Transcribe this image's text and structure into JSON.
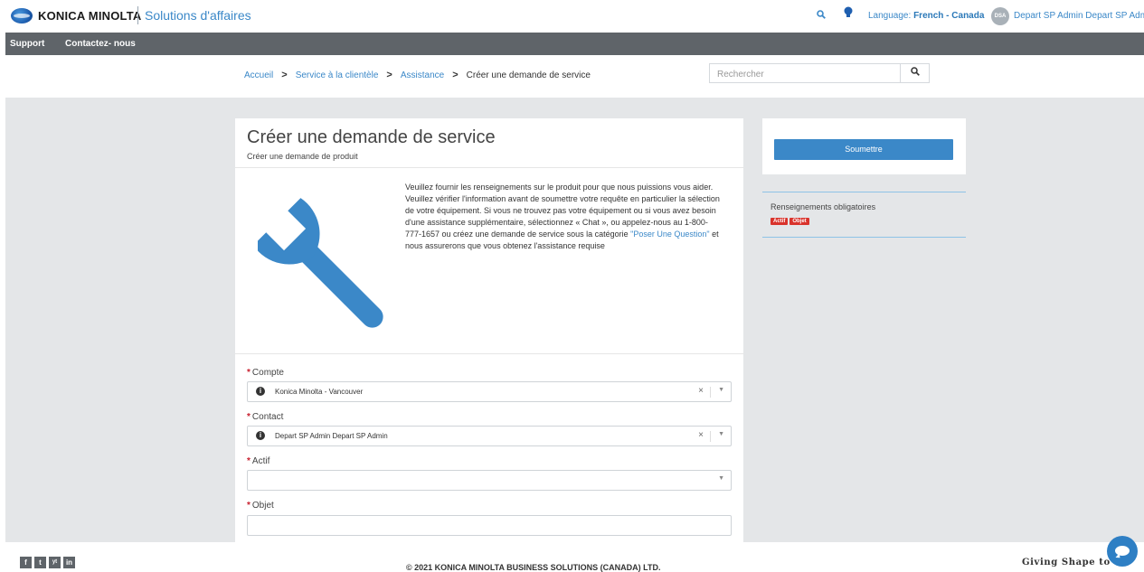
{
  "header": {
    "brand": "KONICA MINOLTA",
    "brand_sub": "Solutions d'affaires",
    "language_label": "Language:",
    "language_value": "French - Canada",
    "avatar_initials": "DSA",
    "user_name": "Depart SP Admin Depart SP Adm"
  },
  "nav": {
    "items": [
      {
        "label": "Support"
      },
      {
        "label": "Contactez- nous"
      }
    ]
  },
  "breadcrumb": {
    "items": [
      {
        "label": "Accueil"
      },
      {
        "label": "Service à la clientèle"
      },
      {
        "label": "Assistance"
      }
    ],
    "current": "Créer une demande de service",
    "separator": ">"
  },
  "search": {
    "placeholder": "Rechercher"
  },
  "form": {
    "title": "Créer une demande de service",
    "subtitle": "Créer une demande de produit",
    "intro_before_link": "Veuillez fournir les renseignements sur le produit pour que nous puissions vous aider. Veuillez vérifier l'information avant de soumettre votre requête en particulier la sélection de votre équipement. Si vous ne trouvez pas votre équipement ou si vous avez besoin d'une assistance supplémentaire, sélectionnez « Chat », ou appelez-nous au 1-800-777-1657 ou créez une demande de service sous la catégorie ",
    "intro_link": "\"Poser Une Question\"",
    "intro_after_link": " et nous assurerons que vous obtenez l'assistance requise",
    "fields": [
      {
        "label": "Compte",
        "required": "*",
        "value": "Konica Minolta - Vancouver"
      },
      {
        "label": "Contact",
        "required": "*",
        "value": "Depart SP Admin Depart SP Admin"
      },
      {
        "label": "Actif",
        "required": "*",
        "value": ""
      },
      {
        "label": "Objet",
        "required": "*",
        "value": ""
      }
    ],
    "clear_glyph": "×",
    "dropdown_glyph": "▼"
  },
  "side": {
    "submit_label": "Soumettre",
    "required_title": "Renseignements obligatoires",
    "required_badges": [
      "Actif",
      "Objet"
    ]
  },
  "footer": {
    "social": [
      "f",
      "t",
      "yt",
      "in"
    ],
    "copyright": "© 2021 KONICA MINOLTA BUSINESS SOLUTIONS (CANADA) LTD.",
    "tagline": "Giving Shape to"
  },
  "colors": {
    "accent": "#3b88c8",
    "nav_bg": "#5f6469",
    "badge": "#d9332c",
    "page_bg": "#e4e6e8"
  }
}
